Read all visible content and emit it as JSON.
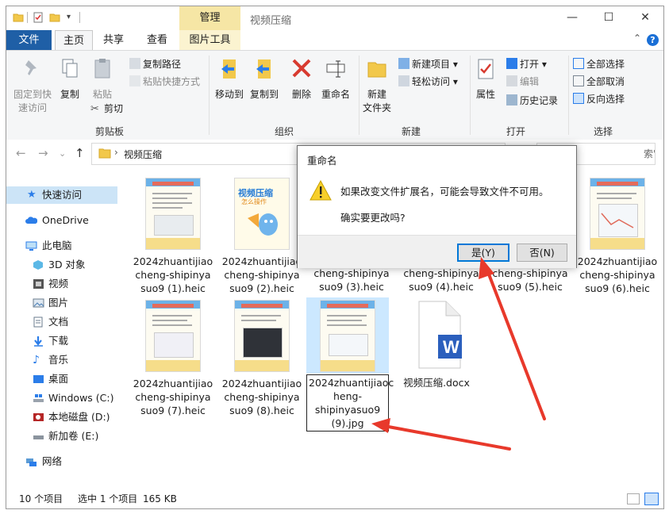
{
  "window": {
    "title": "视频压缩",
    "context_tab_header": "管理"
  },
  "window_controls": {
    "minimize": "—",
    "maximize": "☐",
    "close": "✕"
  },
  "tabs": {
    "file": "文件",
    "home": "主页",
    "share": "共享",
    "view": "查看",
    "picture_tools": "图片工具",
    "help": "?"
  },
  "ribbon": {
    "clipboard": {
      "pin_label_1": "固定到快",
      "pin_label_2": "速访问",
      "copy": "复制",
      "paste": "粘贴",
      "copy_path": "复制路径",
      "paste_shortcut": "粘贴快捷方式",
      "cut": "剪切",
      "group": "剪贴板"
    },
    "organize": {
      "move_to": "移动到",
      "copy_to": "复制到",
      "delete": "删除",
      "rename": "重命名",
      "group": "组织"
    },
    "new": {
      "new_folder_1": "新建",
      "new_folder_2": "文件夹",
      "new_item": "新建项目",
      "easy_access": "轻松访问",
      "group": "新建"
    },
    "open": {
      "properties": "属性",
      "open": "打开",
      "edit": "编辑",
      "history": "历史记录",
      "group": "打开"
    },
    "select": {
      "select_all": "全部选择",
      "select_none": "全部取消",
      "invert": "反向选择",
      "group": "选择"
    }
  },
  "address": {
    "path": "视频压缩",
    "search_placeholder": "索\"视频压缩\""
  },
  "sidebar": {
    "quick_access": "快速访问",
    "onedrive": "OneDrive",
    "this_pc": "此电脑",
    "objects3d": "3D 对象",
    "videos": "视频",
    "pictures": "图片",
    "documents": "文档",
    "downloads": "下载",
    "music": "音乐",
    "desktop": "桌面",
    "drive_c": "Windows (C:)",
    "drive_d": "本地磁盘 (D:)",
    "drive_e": "新加卷 (E:)",
    "network": "网络"
  },
  "files": [
    {
      "name": "2024zhuantijiaocheng-shipinyasuo9 (1).heic"
    },
    {
      "name": "2024zhuantijiaocheng-shipinyasuo9 (2).heic",
      "thumb_text_1": "视频压缩",
      "thumb_text_2": "怎么操作"
    },
    {
      "name": "cheng-shipinya suo9 (3).heic"
    },
    {
      "name": "cheng-shipinya suo9 (4).heic"
    },
    {
      "name": "cheng-shipinya suo9 (5).heic"
    },
    {
      "name": "2024zhuantijiaocheng-shipinyasuo9 (6).heic"
    },
    {
      "name": "2024zhuantijiaocheng-shipinyasuo9 (7).heic"
    },
    {
      "name": "2024zhuantijiaocheng-shipinyasuo9 (8).heic"
    },
    {
      "name": "2024zhuantijiaocheng-shipinyasuo9 (9).jpg"
    },
    {
      "name": "视频压缩.docx"
    }
  ],
  "file_labels": {
    "f1_l1": "2024zhuantijiao",
    "f1_l2": "cheng-shipinya",
    "f1_l3": "suo9 (1).heic",
    "f2_l1": "2024zhuantijiao",
    "f2_l2": "cheng-shipinya",
    "f2_l3": "suo9 (2).heic",
    "f3_l2": "cheng-shipinya",
    "f3_l3": "suo9 (3).heic",
    "f4_l2": "cheng-shipinya",
    "f4_l3": "suo9 (4).heic",
    "f5_l2": "cheng-shipinya",
    "f5_l3": "suo9 (5).heic",
    "f6_l1": "2024zhuantijiao",
    "f6_l2": "cheng-shipinya",
    "f6_l3": "suo9 (6).heic",
    "f7_l1": "2024zhuantijiao",
    "f7_l2": "cheng-shipinya",
    "f7_l3": "suo9 (7).heic",
    "f8_l1": "2024zhuantijiao",
    "f8_l2": "cheng-shipinya",
    "f8_l3": "suo9 (8).heic",
    "f9_l1": "2024zhuantijiaoc",
    "f9_l2": "heng-",
    "f9_l3": "shipinyasuo9",
    "f9_l4": "(9).jpg",
    "f10": "视频压缩.docx"
  },
  "status": {
    "count": "10 个项目",
    "selected": "选中 1 个项目",
    "size": "165 KB"
  },
  "dialog": {
    "title": "重命名",
    "message": "如果改变文件扩展名，可能会导致文件不可用。",
    "question": "确实要更改吗?",
    "yes": "是(Y)",
    "no": "否(N)"
  },
  "colors": {
    "accent": "#1f5fa6",
    "selection": "#cce8ff",
    "context_tab": "#f6e6a5",
    "annotation_arrow": "#e8392b"
  }
}
